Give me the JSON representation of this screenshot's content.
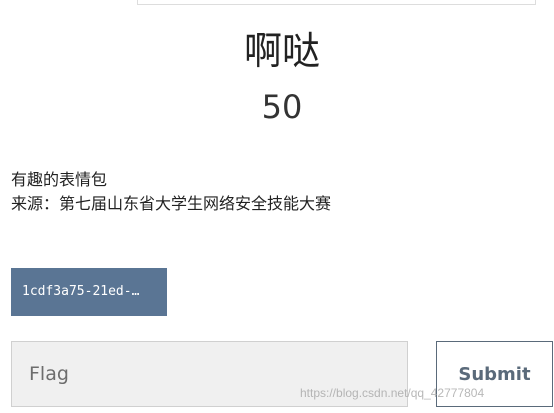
{
  "challenge": {
    "title": "啊哒",
    "value": "50",
    "description_lines": [
      "有趣的表情包",
      "来源：第七届山东省大学生网络安全技能大赛"
    ],
    "file_label": "1cdf3a75-21ed-…"
  },
  "form": {
    "flag_placeholder": "Flag",
    "submit_label": "Submit"
  },
  "watermark": "https://blog.csdn.net/qq_42777804",
  "colors": {
    "file_button": "#5a7594",
    "submit_border": "#5a6a7a",
    "input_bg": "#f0f0f0"
  }
}
